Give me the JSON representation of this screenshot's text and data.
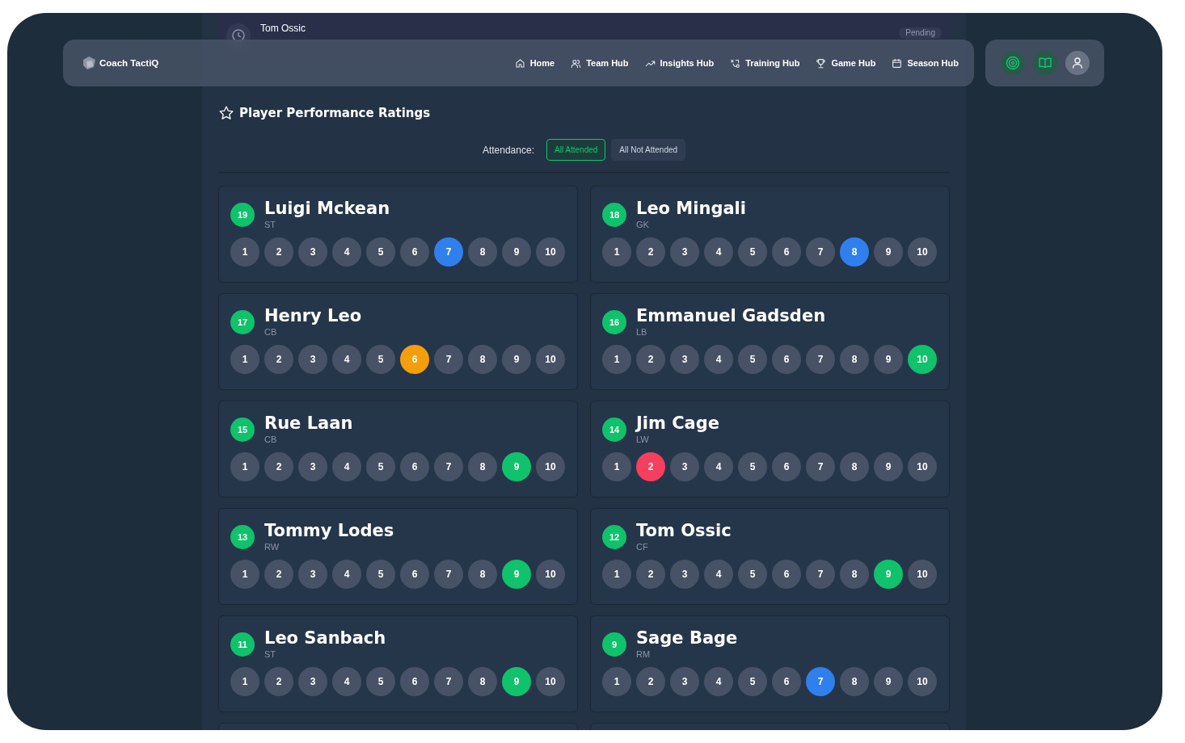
{
  "notification": {
    "name": "Tom Ossic",
    "status": "Pending"
  },
  "nav": {
    "brand": "Coach TactiQ",
    "items": [
      {
        "label": "Home",
        "kind": "home"
      },
      {
        "label": "Team Hub",
        "kind": "team"
      },
      {
        "label": "Insights Hub",
        "kind": "trend"
      },
      {
        "label": "Training Hub",
        "kind": "training"
      },
      {
        "label": "Game Hub",
        "kind": "trophy"
      },
      {
        "label": "Season Hub",
        "kind": "calendar"
      }
    ]
  },
  "title": "Player Performance Ratings",
  "filter": {
    "label": "Attendance:",
    "options": [
      {
        "label": "All Attended",
        "selected": true
      },
      {
        "label": "All Not Attended",
        "selected": false
      }
    ]
  },
  "players": [
    {
      "number": "19",
      "name": "Luigi Mckean",
      "position": "ST",
      "color": "#2f80ed",
      "ratings": [
        {
          "label": "1",
          "selected": false
        },
        {
          "label": "2",
          "selected": false
        },
        {
          "label": "3",
          "selected": false
        },
        {
          "label": "4",
          "selected": false
        },
        {
          "label": "5",
          "selected": false
        },
        {
          "label": "6",
          "selected": false
        },
        {
          "label": "7",
          "selected": true
        },
        {
          "label": "8",
          "selected": false
        },
        {
          "label": "9",
          "selected": false
        },
        {
          "label": "10",
          "selected": false
        }
      ]
    },
    {
      "number": "18",
      "name": "Leo Mingali",
      "position": "GK",
      "color": "#2f80ed",
      "ratings": [
        {
          "label": "1",
          "selected": false
        },
        {
          "label": "2",
          "selected": false
        },
        {
          "label": "3",
          "selected": false
        },
        {
          "label": "4",
          "selected": false
        },
        {
          "label": "5",
          "selected": false
        },
        {
          "label": "6",
          "selected": false
        },
        {
          "label": "7",
          "selected": false
        },
        {
          "label": "8",
          "selected": true
        },
        {
          "label": "9",
          "selected": false
        },
        {
          "label": "10",
          "selected": false
        }
      ]
    },
    {
      "number": "17",
      "name": "Henry Leo",
      "position": "CB",
      "color": "#f59e0b",
      "ratings": [
        {
          "label": "1",
          "selected": false
        },
        {
          "label": "2",
          "selected": false
        },
        {
          "label": "3",
          "selected": false
        },
        {
          "label": "4",
          "selected": false
        },
        {
          "label": "5",
          "selected": false
        },
        {
          "label": "6",
          "selected": true
        },
        {
          "label": "7",
          "selected": false
        },
        {
          "label": "8",
          "selected": false
        },
        {
          "label": "9",
          "selected": false
        },
        {
          "label": "10",
          "selected": false
        }
      ]
    },
    {
      "number": "16",
      "name": "Emmanuel Gadsden",
      "position": "LB",
      "color": "#0fc26b",
      "ratings": [
        {
          "label": "1",
          "selected": false
        },
        {
          "label": "2",
          "selected": false
        },
        {
          "label": "3",
          "selected": false
        },
        {
          "label": "4",
          "selected": false
        },
        {
          "label": "5",
          "selected": false
        },
        {
          "label": "6",
          "selected": false
        },
        {
          "label": "7",
          "selected": false
        },
        {
          "label": "8",
          "selected": false
        },
        {
          "label": "9",
          "selected": false
        },
        {
          "label": "10",
          "selected": true
        }
      ]
    },
    {
      "number": "15",
      "name": "Rue Laan",
      "position": "CB",
      "color": "#0fc26b",
      "ratings": [
        {
          "label": "1",
          "selected": false
        },
        {
          "label": "2",
          "selected": false
        },
        {
          "label": "3",
          "selected": false
        },
        {
          "label": "4",
          "selected": false
        },
        {
          "label": "5",
          "selected": false
        },
        {
          "label": "6",
          "selected": false
        },
        {
          "label": "7",
          "selected": false
        },
        {
          "label": "8",
          "selected": false
        },
        {
          "label": "9",
          "selected": true
        },
        {
          "label": "10",
          "selected": false
        }
      ]
    },
    {
      "number": "14",
      "name": "Jim Cage",
      "position": "LW",
      "color": "#f43f5e",
      "ratings": [
        {
          "label": "1",
          "selected": false
        },
        {
          "label": "2",
          "selected": true
        },
        {
          "label": "3",
          "selected": false
        },
        {
          "label": "4",
          "selected": false
        },
        {
          "label": "5",
          "selected": false
        },
        {
          "label": "6",
          "selected": false
        },
        {
          "label": "7",
          "selected": false
        },
        {
          "label": "8",
          "selected": false
        },
        {
          "label": "9",
          "selected": false
        },
        {
          "label": "10",
          "selected": false
        }
      ]
    },
    {
      "number": "13",
      "name": "Tommy Lodes",
      "position": "RW",
      "color": "#0fc26b",
      "ratings": [
        {
          "label": "1",
          "selected": false
        },
        {
          "label": "2",
          "selected": false
        },
        {
          "label": "3",
          "selected": false
        },
        {
          "label": "4",
          "selected": false
        },
        {
          "label": "5",
          "selected": false
        },
        {
          "label": "6",
          "selected": false
        },
        {
          "label": "7",
          "selected": false
        },
        {
          "label": "8",
          "selected": false
        },
        {
          "label": "9",
          "selected": true
        },
        {
          "label": "10",
          "selected": false
        }
      ]
    },
    {
      "number": "12",
      "name": "Tom Ossic",
      "position": "CF",
      "color": "#0fc26b",
      "ratings": [
        {
          "label": "1",
          "selected": false
        },
        {
          "label": "2",
          "selected": false
        },
        {
          "label": "3",
          "selected": false
        },
        {
          "label": "4",
          "selected": false
        },
        {
          "label": "5",
          "selected": false
        },
        {
          "label": "6",
          "selected": false
        },
        {
          "label": "7",
          "selected": false
        },
        {
          "label": "8",
          "selected": false
        },
        {
          "label": "9",
          "selected": true
        },
        {
          "label": "10",
          "selected": false
        }
      ]
    },
    {
      "number": "11",
      "name": "Leo Sanbach",
      "position": "ST",
      "color": "#0fc26b",
      "ratings": [
        {
          "label": "1",
          "selected": false
        },
        {
          "label": "2",
          "selected": false
        },
        {
          "label": "3",
          "selected": false
        },
        {
          "label": "4",
          "selected": false
        },
        {
          "label": "5",
          "selected": false
        },
        {
          "label": "6",
          "selected": false
        },
        {
          "label": "7",
          "selected": false
        },
        {
          "label": "8",
          "selected": false
        },
        {
          "label": "9",
          "selected": true
        },
        {
          "label": "10",
          "selected": false
        }
      ]
    },
    {
      "number": "9",
      "name": "Sage Bage",
      "position": "RM",
      "color": "#2f80ed",
      "ratings": [
        {
          "label": "1",
          "selected": false
        },
        {
          "label": "2",
          "selected": false
        },
        {
          "label": "3",
          "selected": false
        },
        {
          "label": "4",
          "selected": false
        },
        {
          "label": "5",
          "selected": false
        },
        {
          "label": "6",
          "selected": false
        },
        {
          "label": "7",
          "selected": true
        },
        {
          "label": "8",
          "selected": false
        },
        {
          "label": "9",
          "selected": false
        },
        {
          "label": "10",
          "selected": false
        }
      ]
    }
  ]
}
